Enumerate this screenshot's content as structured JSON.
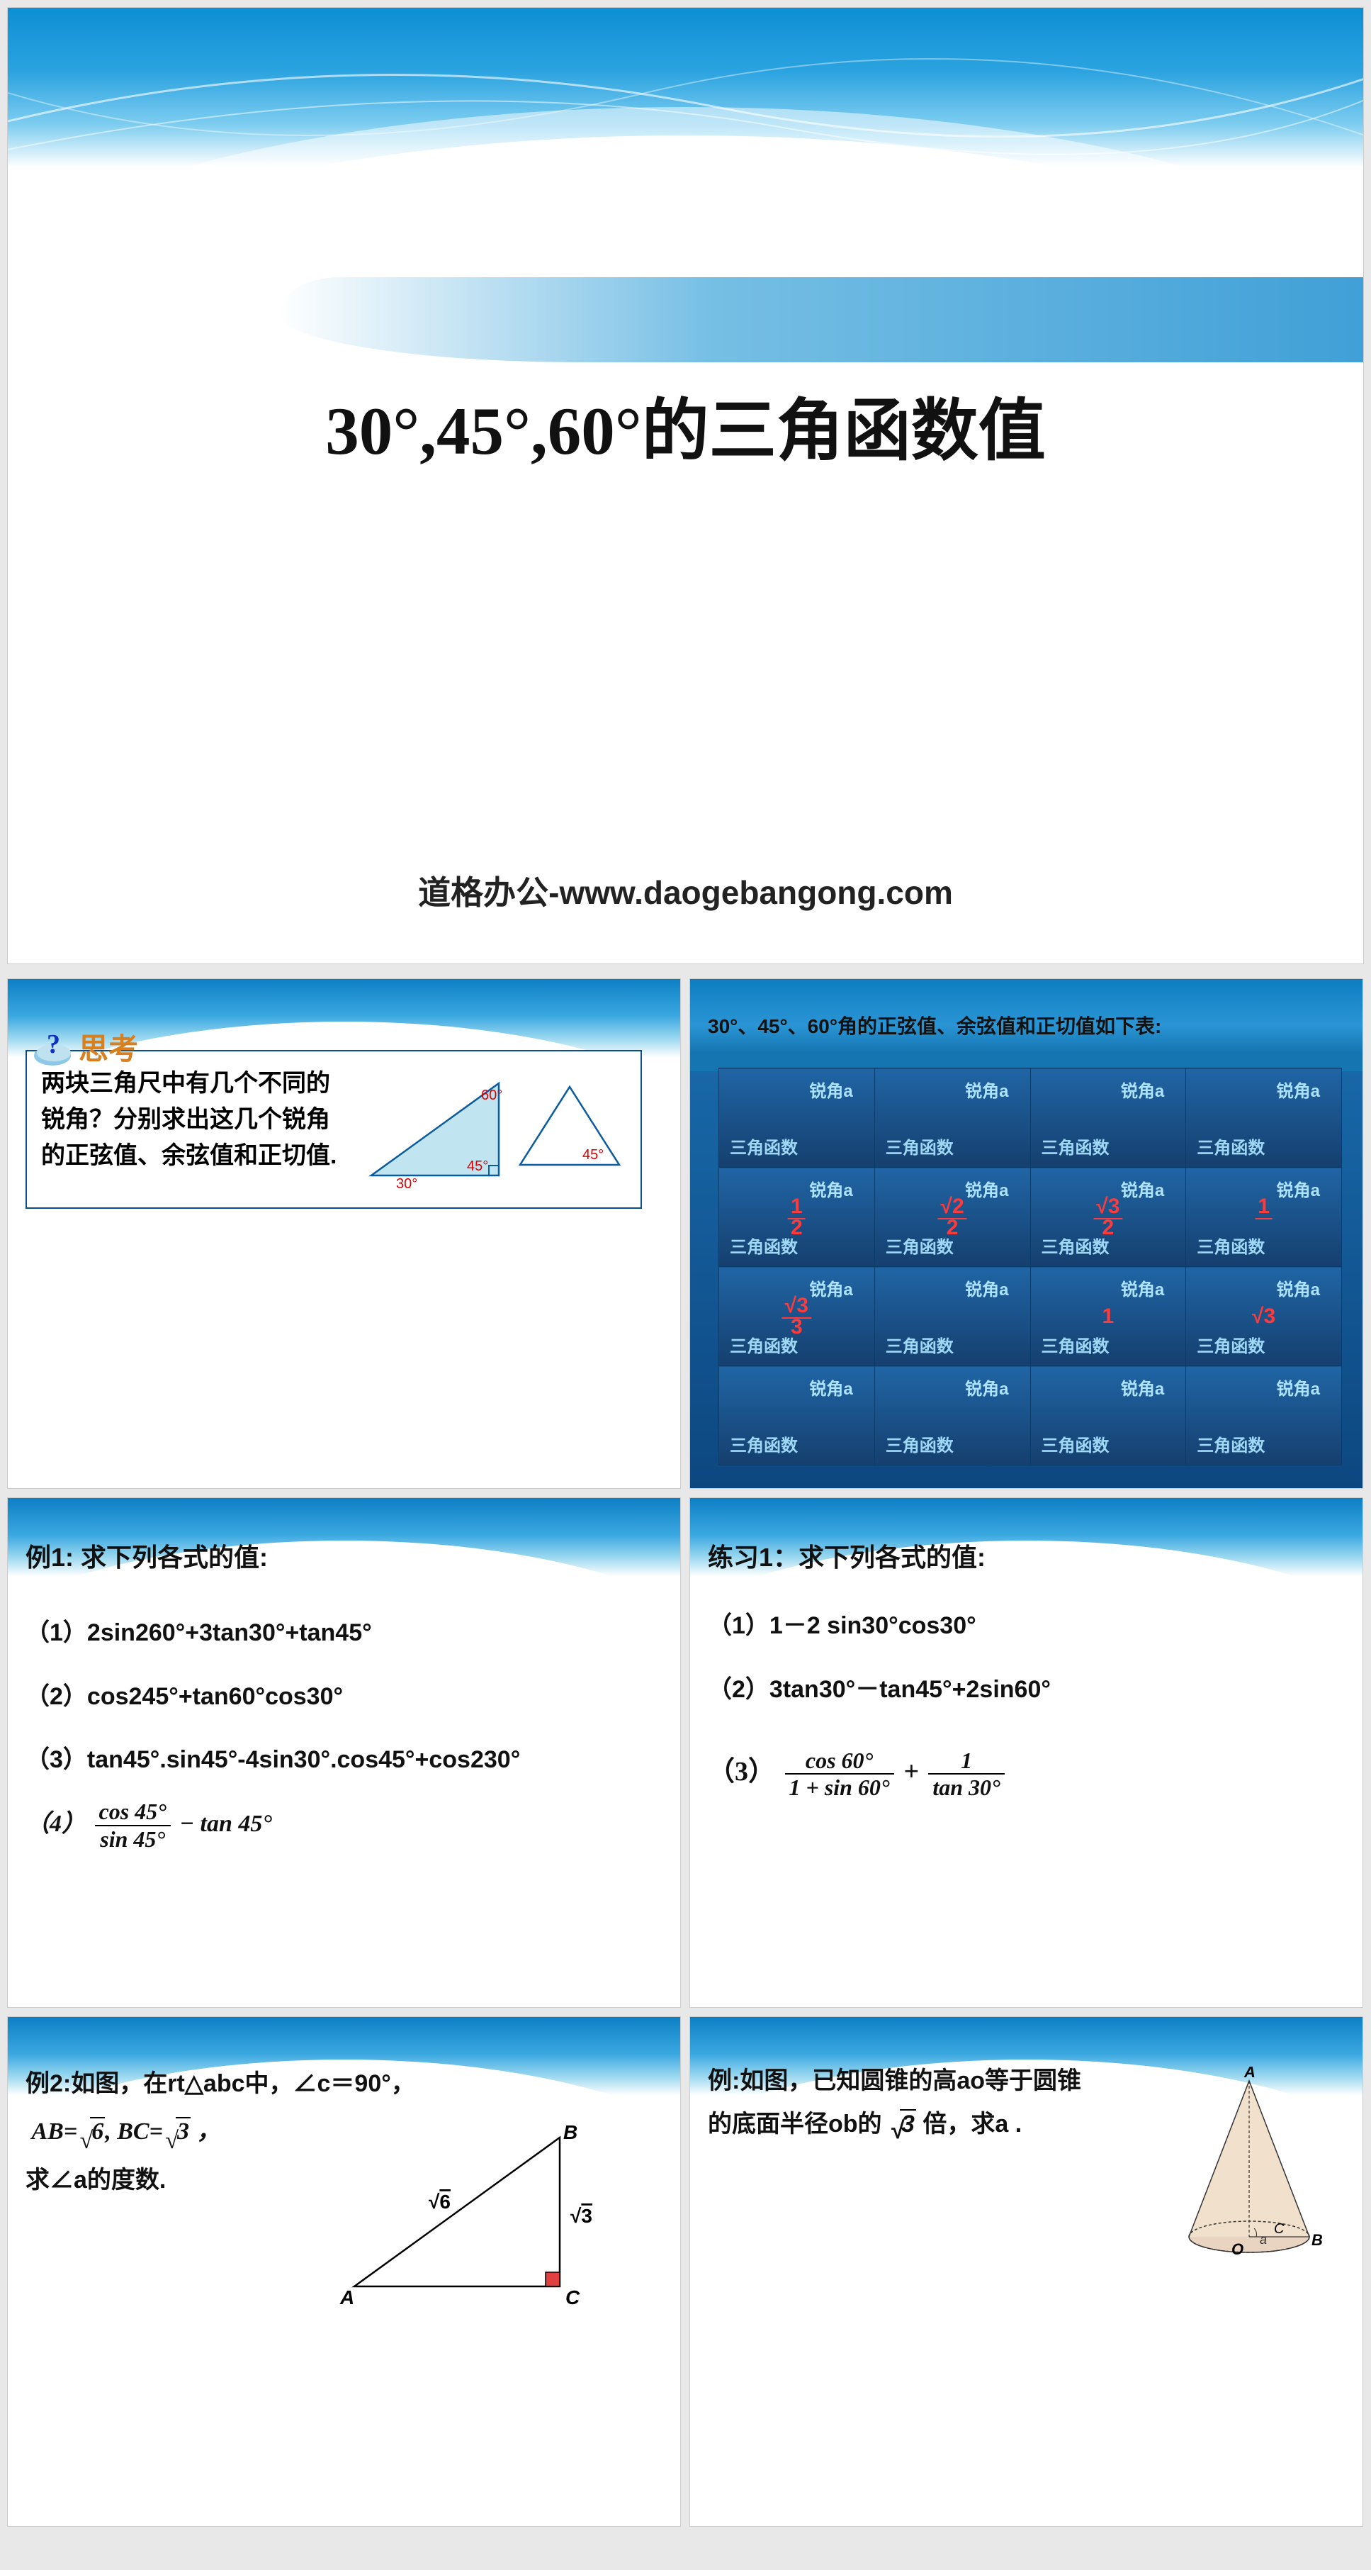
{
  "main": {
    "title": "30°,45°,60°的三角函数值",
    "footer": "道格办公-www.daogebangong.com"
  },
  "slide2": {
    "label": "思考",
    "text": "两块三角尺中有几个不同的锐角？分别求出这几个锐角的正弦值、余弦值和正切值.",
    "angles": {
      "a60": "60°",
      "a30": "30°",
      "a45a": "45°",
      "a45b": "45°"
    }
  },
  "slide3": {
    "title": "30°、45°、60°角的正弦值、余弦值和正切值如下表:",
    "cell": {
      "top": "锐角a",
      "bot": "三角函数"
    },
    "vals": {
      "r1c1": "1/2",
      "r1c2": "√2/2",
      "r1c3": "√3/2",
      "r1c4": "1",
      "r2c1": "√3/3",
      "r2c2": "",
      "r2c3": "1",
      "r2c4": "√3"
    }
  },
  "slide4": {
    "title": "例1: 求下列各式的值:",
    "l1": "（1）2sin260°+3tan30°+tan45°",
    "l2": "（2）cos245°+tan60°cos30°",
    "l3": "（3）tan45°.sin45°-4sin30°.cos45°+cos230°",
    "l4_pre": "（4）",
    "l4_num": "cos 45°",
    "l4_den": "sin 45°",
    "l4_post": " − tan 45°"
  },
  "slide5": {
    "title": "练习1：求下列各式的值:",
    "l1": "（1）1－2 sin30°cos30°",
    "l2": "（2）3tan30°－tan45°+2sin60°",
    "l3_pre": "（3） ",
    "l3_f1_num": "cos 60°",
    "l3_f1_den": "1 + sin 60°",
    "l3_plus": " + ",
    "l3_f2_num": "1",
    "l3_f2_den": "tan 30°"
  },
  "slide6": {
    "title_a": "例2:如图，在rt△abc中，∠c＝90°，",
    "title_b": "AB=√6, BC=√3 ，",
    "title_c": "求∠a的度数.",
    "labels": {
      "A": "A",
      "B": "B",
      "C": "C",
      "ab": "√6",
      "bc": "√3"
    }
  },
  "slide7": {
    "title_a": "例:如图，已知圆锥的高ao等于圆锥",
    "title_b": "的底面半径ob的 √3 倍，求a .",
    "labels": {
      "A": "A",
      "O": "O",
      "B": "B",
      "C": "C",
      "a": "a"
    }
  }
}
